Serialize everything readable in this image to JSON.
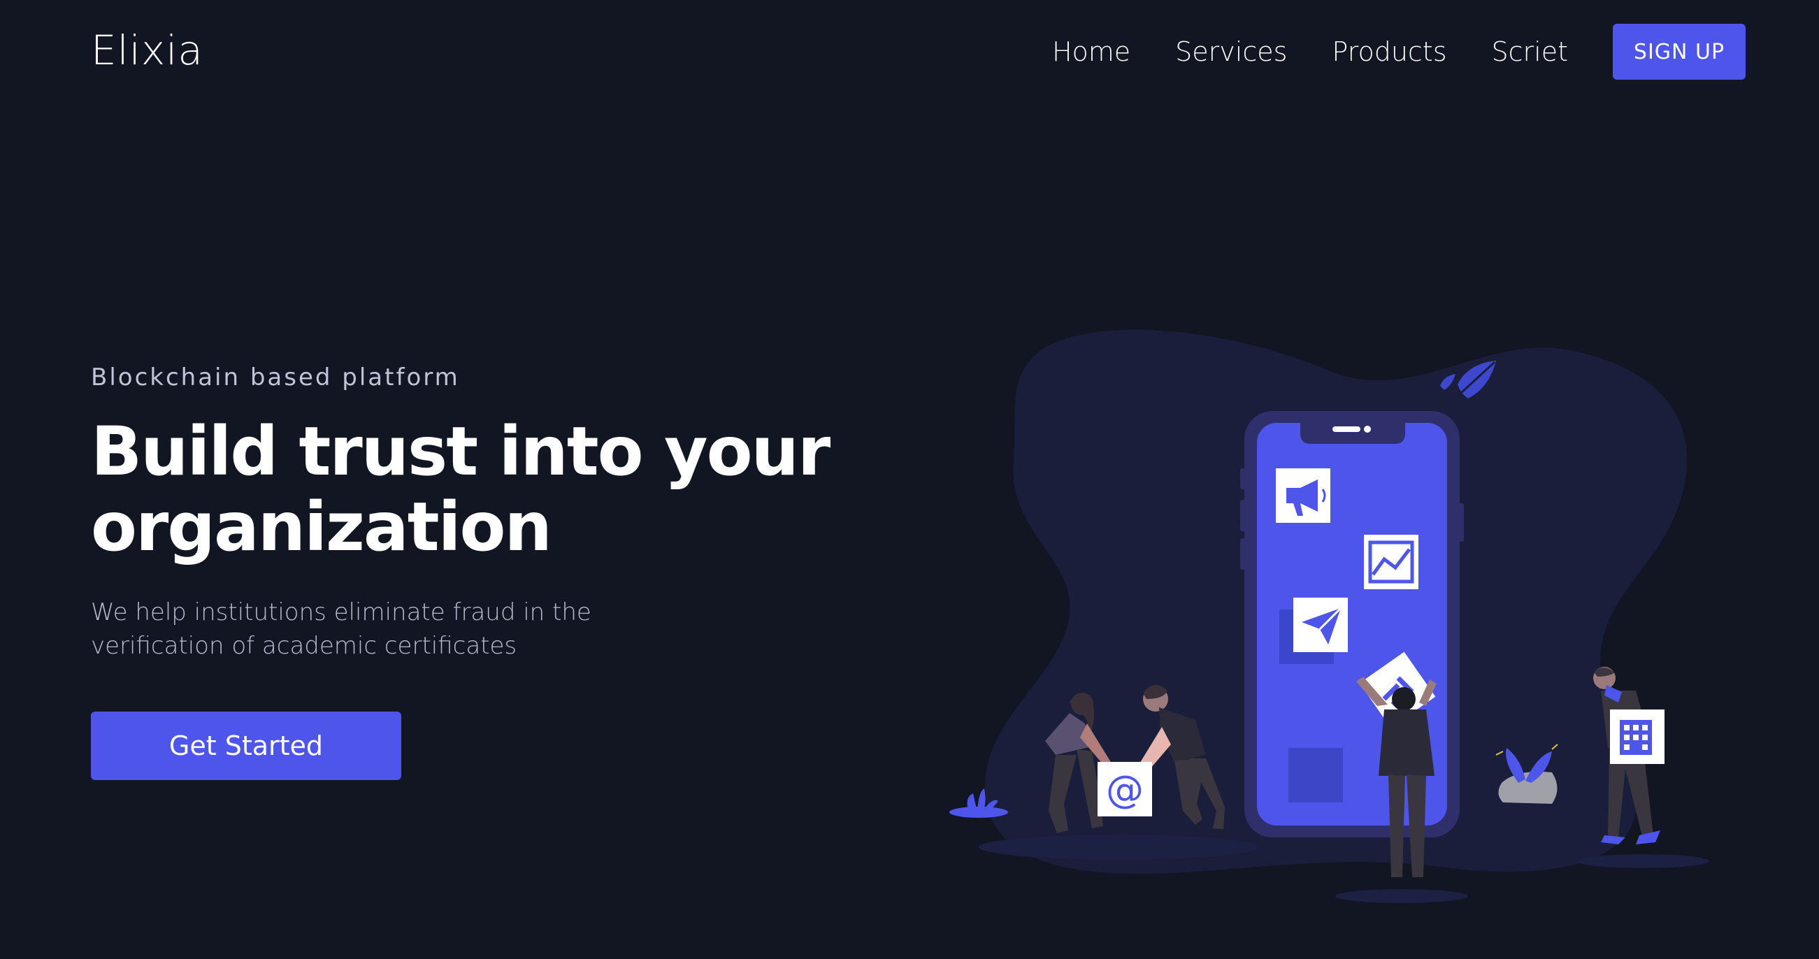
{
  "brand": {
    "name": "Elixia"
  },
  "nav": {
    "items": [
      {
        "label": "Home"
      },
      {
        "label": "Services"
      },
      {
        "label": "Products"
      },
      {
        "label": "Scriet"
      }
    ],
    "signup_label": "SIGN UP"
  },
  "hero": {
    "eyebrow": "Blockchain based platform",
    "headline_line1": "Build trust into your",
    "headline_line2": "organization",
    "subtext": "We help institutions eliminate fraud in the verification of academic certificates",
    "cta_label": "Get Started"
  },
  "illustration": {
    "phone_icons": [
      "megaphone-icon",
      "chart-icon",
      "paper-plane-icon",
      "document-icon"
    ],
    "card_icons": [
      "at-sign-icon",
      "building-icon"
    ],
    "at_symbol": "@"
  },
  "colors": {
    "background": "#121622",
    "accent": "#4d55eb",
    "blob": "#1a1e3a",
    "phone_frame": "#2f2f6b",
    "text_muted": "#b8bccd"
  }
}
